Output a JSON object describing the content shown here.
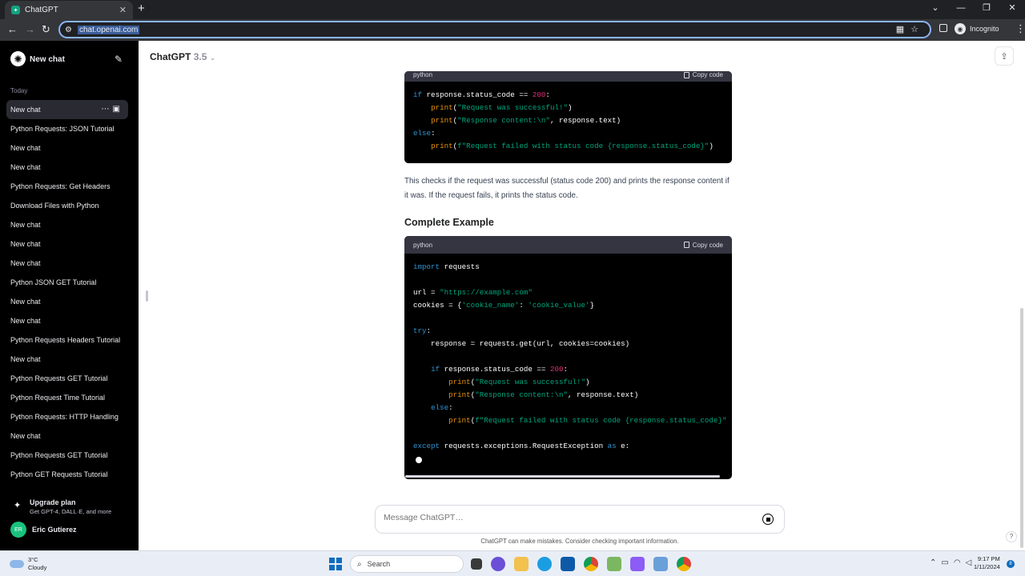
{
  "browser": {
    "tab_title": "ChatGPT",
    "url": "chat.openai.com",
    "profile_label": "Incognito"
  },
  "sidebar": {
    "new_chat_label": "New chat",
    "section_label": "Today",
    "items": [
      {
        "label": "New chat",
        "active": true
      },
      {
        "label": "Python Requests: JSON Tutorial"
      },
      {
        "label": "New chat"
      },
      {
        "label": "New chat"
      },
      {
        "label": "Python Requests: Get Headers"
      },
      {
        "label": "Download Files with Python"
      },
      {
        "label": "New chat"
      },
      {
        "label": "New chat"
      },
      {
        "label": "New chat"
      },
      {
        "label": "Python JSON GET Tutorial"
      },
      {
        "label": "New chat"
      },
      {
        "label": "New chat"
      },
      {
        "label": "Python Requests Headers Tutorial"
      },
      {
        "label": "New chat"
      },
      {
        "label": "Python Requests GET Tutorial"
      },
      {
        "label": "Python Request Time Tutorial"
      },
      {
        "label": "Python Requests: HTTP Handling"
      },
      {
        "label": "New chat"
      },
      {
        "label": "Python Requests GET Tutorial"
      },
      {
        "label": "Python GET Requests Tutorial"
      }
    ],
    "upgrade_title": "Upgrade plan",
    "upgrade_subtitle": "Get GPT-4, DALL·E, and more",
    "user_initials": "ER",
    "user_name": "Eric Gutierez"
  },
  "header": {
    "model_name": "ChatGPT",
    "model_version": "3.5"
  },
  "conversation": {
    "code_block_1": {
      "language": "python",
      "copy_label": "Copy code"
    },
    "paragraph": "This checks if the request was successful (status code 200) and prints the response content if it was. If the request fails, it prints the status code.",
    "heading": "Complete Example",
    "code_block_2": {
      "language": "python",
      "copy_label": "Copy code"
    }
  },
  "composer": {
    "placeholder": "Message ChatGPT…",
    "disclaimer": "ChatGPT can make mistakes. Consider checking important information."
  },
  "taskbar": {
    "temperature": "3°C",
    "weather": "Cloudy",
    "search_label": "Search",
    "time": "9:17 PM",
    "date": "1/11/2024",
    "notification_count": "8"
  },
  "colors": {
    "sidebar_bg": "#000000",
    "code_bg": "#000000",
    "code_header_bg": "#343541",
    "keyword": "#2e95d3",
    "string": "#00a67d",
    "number": "#df3079",
    "accent_focus": "#8ab4f8"
  },
  "icons": [
    "chatgpt-logo-icon",
    "edit-icon",
    "more-icon",
    "archive-icon",
    "sparkle-icon",
    "share-icon",
    "copy-icon",
    "stop-icon",
    "help-icon"
  ]
}
